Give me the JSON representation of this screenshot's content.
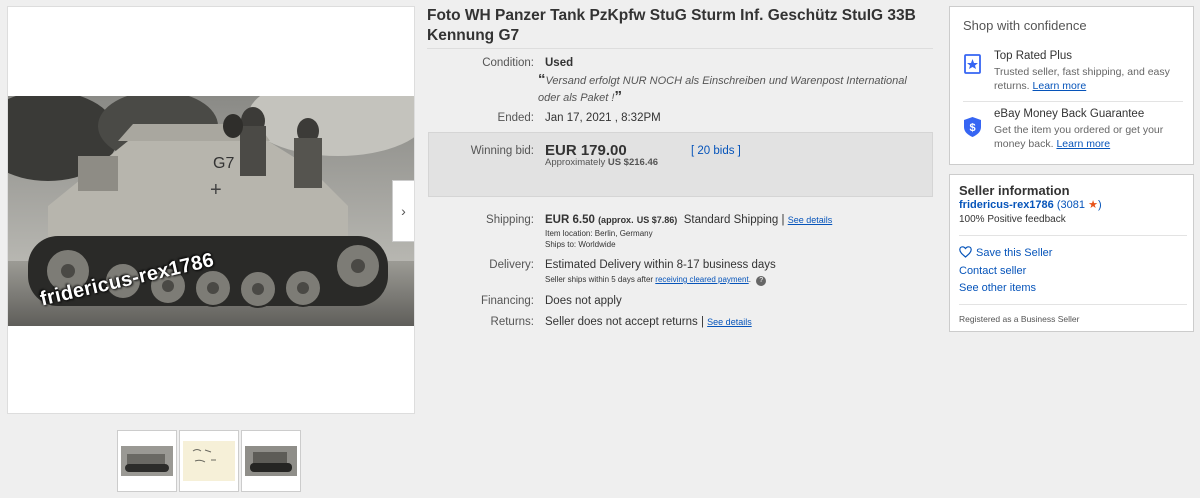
{
  "gallery": {
    "watermark": "fridericus-rex1786",
    "next_arrow": "›",
    "thumbs": [
      {
        "kind": "tank-photo"
      },
      {
        "kind": "handwritten-back"
      },
      {
        "kind": "tank-photo"
      }
    ]
  },
  "listing": {
    "title": "Foto WH Panzer Tank PzKpfw StuG Sturm Inf. Geschütz StuIG 33B Kennung G7",
    "condition_label": "Condition:",
    "condition_value": "Used",
    "quote_open": "“",
    "quote_text": "Versand erfolgt NUR NOCH als Einschreiben und Warenpost International oder als Paket !",
    "quote_close": "”",
    "ended_label": "Ended:",
    "ended_value": "Jan 17, 2021 , 8:32PM",
    "winning_bid_label": "Winning bid:",
    "winning_bid_price": "EUR 179.00",
    "approx_prefix": "Approximately",
    "approx_value": "US $216.46",
    "bids": "[ 20 bids ]",
    "shipping_label": "Shipping:",
    "shipping_price": "EUR 6.50",
    "shipping_approx": "(approx.",
    "shipping_usd": "US $7.86)",
    "shipping_method": "Standard Shipping |",
    "shipping_details_link": "See details",
    "item_location": "Item location:  Berlin, Germany",
    "ships_to": "Ships to:  Worldwide",
    "delivery_label": "Delivery:",
    "delivery_value": "Estimated Delivery within 8-17 business days",
    "delivery_note_prefix": "Seller ships within 5 days after",
    "delivery_note_link": "receiving cleared payment",
    "delivery_note_suffix": ".",
    "help_icon": "?",
    "financing_label": "Financing:",
    "financing_value": "Does not apply",
    "returns_label": "Returns:",
    "returns_value": "Seller does not accept returns |",
    "returns_link": "See details"
  },
  "confidence": {
    "heading": "Shop with confidence",
    "top_rated_title": "Top Rated Plus",
    "top_rated_desc": "Trusted seller, fast shipping, and easy returns.",
    "top_rated_link": "Learn more",
    "mbg_title": "eBay Money Back Guarantee",
    "mbg_desc": "Get the item you ordered or get your money back.",
    "mbg_link": "Learn more",
    "accent": "#3665f3"
  },
  "seller": {
    "heading": "Seller information",
    "name": "fridericus-rex1786",
    "score_open": "(",
    "score": "3081",
    "star": "★",
    "score_close": ")",
    "feedback": "100% Positive feedback",
    "save_label": "Save this Seller",
    "contact_label": "Contact seller",
    "other_items_label": "See other items",
    "registered": "Registered as a Business Seller",
    "link_color": "#0654ba",
    "star_color": "#e8531a"
  }
}
